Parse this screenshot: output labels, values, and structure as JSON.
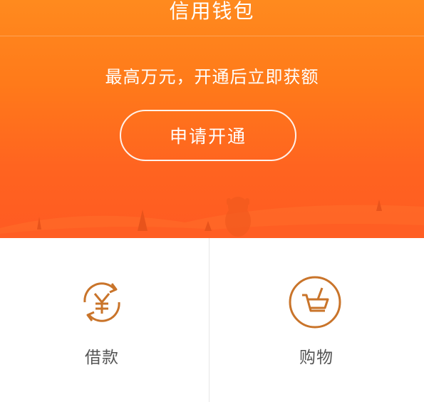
{
  "header": {
    "title": "信用钱包"
  },
  "promo": {
    "subtitle": "最高万元，开通后立即获额",
    "apply_button": "申请开通"
  },
  "actions": [
    {
      "label": "借款",
      "icon": "yen-exchange-icon"
    },
    {
      "label": "购物",
      "icon": "shopping-cart-icon"
    }
  ],
  "colors": {
    "brand_orange": "#ff7a1a",
    "icon_stroke": "#c9742a",
    "label_text": "#555555"
  }
}
